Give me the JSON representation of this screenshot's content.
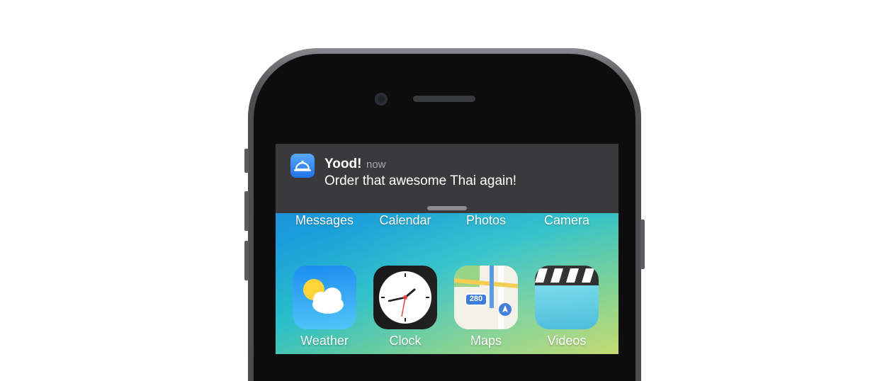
{
  "notification": {
    "app_name": "Yood!",
    "time": "now",
    "message": "Order that awesome Thai again!",
    "icon": "food-cloche-icon"
  },
  "home_screen": {
    "row1": [
      {
        "label": "Messages",
        "icon": "messages-icon"
      },
      {
        "label": "Calendar",
        "icon": "calendar-icon"
      },
      {
        "label": "Photos",
        "icon": "photos-icon"
      },
      {
        "label": "Camera",
        "icon": "camera-icon"
      }
    ],
    "row2": [
      {
        "label": "Weather",
        "icon": "weather-icon"
      },
      {
        "label": "Clock",
        "icon": "clock-icon"
      },
      {
        "label": "Maps",
        "icon": "maps-icon",
        "badge": "280"
      },
      {
        "label": "Videos",
        "icon": "videos-icon"
      }
    ]
  },
  "colors": {
    "banner": "#3a3a3c",
    "accent": "#1f72e8"
  }
}
